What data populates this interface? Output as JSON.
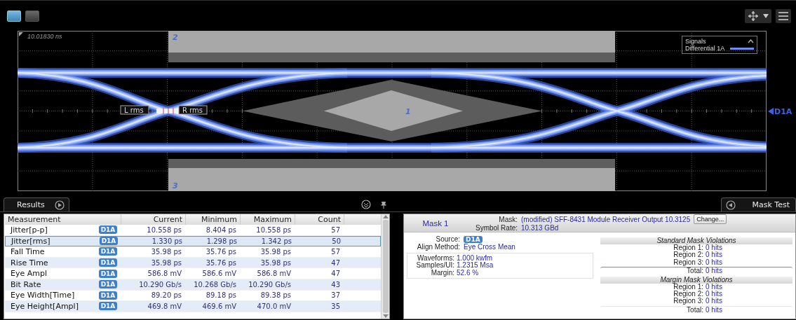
{
  "toolbar": {
    "layout_buttons": [
      {
        "selected": true
      },
      {
        "selected": false
      }
    ]
  },
  "plot": {
    "timestamp": "10.01830 ns",
    "mask_regions": [
      {
        "kind": "top",
        "number": "2"
      },
      {
        "kind": "center",
        "number": "1"
      },
      {
        "kind": "bottom",
        "number": "3"
      }
    ],
    "markers": [
      "L rms",
      "R rms"
    ],
    "legend": {
      "title": "Signals",
      "item": "Differential 1A"
    },
    "channel_marker": "D1A"
  },
  "panel_tabs": {
    "left": "Results",
    "right": "Mask Test"
  },
  "table": {
    "columns": [
      "Measurement",
      "Current",
      "Minimum",
      "Maximum",
      "Count"
    ],
    "rows": [
      {
        "name": "Jitter[p-p]",
        "source": "D1A",
        "current": "10.558 ps",
        "minimum": "8.404 ps",
        "maximum": "10.558 ps",
        "count": "57",
        "selected": false
      },
      {
        "name": "Jitter[rms]",
        "source": "D1A",
        "current": "1.330 ps",
        "minimum": "1.298 ps",
        "maximum": "1.342 ps",
        "count": "50",
        "selected": true
      },
      {
        "name": "Fall Time",
        "source": "D1A",
        "current": "35.98 ps",
        "minimum": "35.76 ps",
        "maximum": "35.98 ps",
        "count": "57",
        "selected": false
      },
      {
        "name": "Rise Time",
        "source": "D1A",
        "current": "35.98 ps",
        "minimum": "35.76 ps",
        "maximum": "35.98 ps",
        "count": "47",
        "selected": false
      },
      {
        "name": "Eye Ampl",
        "source": "D1A",
        "current": "586.8 mV",
        "minimum": "586.6 mV",
        "maximum": "586.8 mV",
        "count": "47",
        "selected": false
      },
      {
        "name": "Bit Rate",
        "source": "D1A",
        "current": "10.290 Gb/s",
        "minimum": "10.268 Gb/s",
        "maximum": "10.290 Gb/s",
        "count": "43",
        "selected": false
      },
      {
        "name": "Eye Width[Time]",
        "source": "D1A",
        "current": "89.20 ps",
        "minimum": "89.18 ps",
        "maximum": "89.38 ps",
        "count": "37",
        "selected": false
      },
      {
        "name": "Eye Height[Ampl]",
        "source": "D1A",
        "current": "469.8 mV",
        "minimum": "469.6 mV",
        "maximum": "470.0 mV",
        "count": "35",
        "selected": false
      }
    ]
  },
  "mask_panel": {
    "title": "Mask 1",
    "mask_label": "Mask:",
    "mask_value": "(modified) SFF-8431 Module Receiver Output 10.3125",
    "change_button": "Change...",
    "symbol_rate_label": "Symbol Rate:",
    "symbol_rate_value": "10.313 GBd",
    "source_label": "Source:",
    "source_value": "D1A",
    "align_label": "Align Method:",
    "align_value": "Eye Cross Mean",
    "stats": [
      {
        "label": "Waveforms:",
        "value": "1.000 kwfm"
      },
      {
        "label": "Samples/UI:",
        "value": "1.2315 Msa"
      },
      {
        "label": "Margin:",
        "value": "52.6 %"
      }
    ],
    "violations": [
      {
        "title": "Standard Mask Violations",
        "rows": [
          {
            "label": "Region 1:",
            "value": "0 hits"
          },
          {
            "label": "Region 2:",
            "value": "0 hits"
          },
          {
            "label": "Region 3:",
            "value": "0 hits"
          }
        ],
        "total": {
          "label": "Total:",
          "value": "0 hits",
          "selected": true
        }
      },
      {
        "title": "Margin Mask Violations",
        "rows": [
          {
            "label": "Region 1:",
            "value": "0 hits"
          },
          {
            "label": "Region 2:",
            "value": "0 hits"
          },
          {
            "label": "Region 3:",
            "value": "0 hits"
          }
        ],
        "total": {
          "label": "Total:",
          "value": "0 hits",
          "selected": false
        }
      }
    ]
  }
}
